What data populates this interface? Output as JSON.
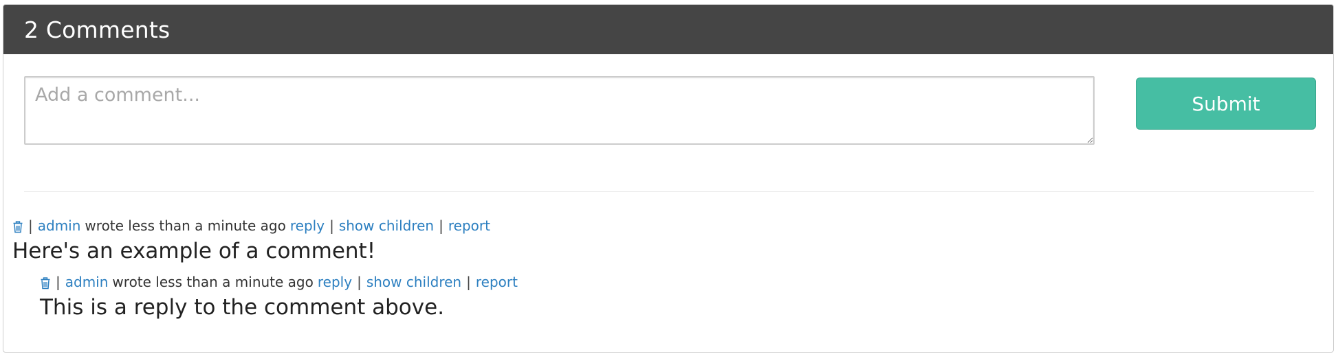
{
  "header": {
    "title": "2 Comments"
  },
  "form": {
    "placeholder": "Add a comment...",
    "submit_label": "Submit"
  },
  "colors": {
    "header_bg": "#454545",
    "submit_bg": "#46bea3",
    "link": "#2c7fc0"
  },
  "comments": [
    {
      "author": "admin",
      "time_text": "wrote less than a minute ago",
      "reply_label": "reply",
      "children_label": "show children",
      "report_label": "report",
      "separator": "|",
      "icon": "trash-icon",
      "body": "Here's an example of a comment!"
    },
    {
      "author": "admin",
      "time_text": "wrote less than a minute ago",
      "reply_label": "reply",
      "children_label": "show children",
      "report_label": "report",
      "separator": "|",
      "icon": "trash-icon",
      "body": "This is a reply to the comment above."
    }
  ]
}
